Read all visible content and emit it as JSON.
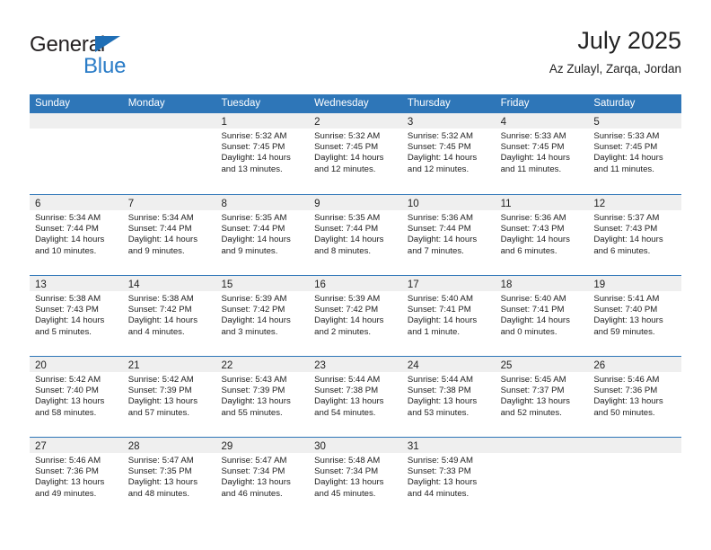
{
  "brand": {
    "name_top": "General",
    "name_bottom": "Blue",
    "triangle_color": "#1f6eb5",
    "text_color_top": "#231f20",
    "text_color_bottom": "#2a7cc7"
  },
  "header": {
    "title": "July 2025",
    "subtitle": "Az Zulayl, Zarqa, Jordan"
  },
  "theme": {
    "header_blue": "#2e76b8",
    "day_band_gray": "#efefef",
    "text": "#222222"
  },
  "weekdays": [
    "Sunday",
    "Monday",
    "Tuesday",
    "Wednesday",
    "Thursday",
    "Friday",
    "Saturday"
  ],
  "weeks": [
    [
      {
        "day": "",
        "empty": true,
        "sunrise": "",
        "sunset": "",
        "daylight": ""
      },
      {
        "day": "",
        "empty": true,
        "sunrise": "",
        "sunset": "",
        "daylight": ""
      },
      {
        "day": "1",
        "sunrise": "Sunrise: 5:32 AM",
        "sunset": "Sunset: 7:45 PM",
        "daylight": "Daylight: 14 hours and 13 minutes."
      },
      {
        "day": "2",
        "sunrise": "Sunrise: 5:32 AM",
        "sunset": "Sunset: 7:45 PM",
        "daylight": "Daylight: 14 hours and 12 minutes."
      },
      {
        "day": "3",
        "sunrise": "Sunrise: 5:32 AM",
        "sunset": "Sunset: 7:45 PM",
        "daylight": "Daylight: 14 hours and 12 minutes."
      },
      {
        "day": "4",
        "sunrise": "Sunrise: 5:33 AM",
        "sunset": "Sunset: 7:45 PM",
        "daylight": "Daylight: 14 hours and 11 minutes."
      },
      {
        "day": "5",
        "sunrise": "Sunrise: 5:33 AM",
        "sunset": "Sunset: 7:45 PM",
        "daylight": "Daylight: 14 hours and 11 minutes."
      }
    ],
    [
      {
        "day": "6",
        "sunrise": "Sunrise: 5:34 AM",
        "sunset": "Sunset: 7:44 PM",
        "daylight": "Daylight: 14 hours and 10 minutes."
      },
      {
        "day": "7",
        "sunrise": "Sunrise: 5:34 AM",
        "sunset": "Sunset: 7:44 PM",
        "daylight": "Daylight: 14 hours and 9 minutes."
      },
      {
        "day": "8",
        "sunrise": "Sunrise: 5:35 AM",
        "sunset": "Sunset: 7:44 PM",
        "daylight": "Daylight: 14 hours and 9 minutes."
      },
      {
        "day": "9",
        "sunrise": "Sunrise: 5:35 AM",
        "sunset": "Sunset: 7:44 PM",
        "daylight": "Daylight: 14 hours and 8 minutes."
      },
      {
        "day": "10",
        "sunrise": "Sunrise: 5:36 AM",
        "sunset": "Sunset: 7:44 PM",
        "daylight": "Daylight: 14 hours and 7 minutes."
      },
      {
        "day": "11",
        "sunrise": "Sunrise: 5:36 AM",
        "sunset": "Sunset: 7:43 PM",
        "daylight": "Daylight: 14 hours and 6 minutes."
      },
      {
        "day": "12",
        "sunrise": "Sunrise: 5:37 AM",
        "sunset": "Sunset: 7:43 PM",
        "daylight": "Daylight: 14 hours and 6 minutes."
      }
    ],
    [
      {
        "day": "13",
        "sunrise": "Sunrise: 5:38 AM",
        "sunset": "Sunset: 7:43 PM",
        "daylight": "Daylight: 14 hours and 5 minutes."
      },
      {
        "day": "14",
        "sunrise": "Sunrise: 5:38 AM",
        "sunset": "Sunset: 7:42 PM",
        "daylight": "Daylight: 14 hours and 4 minutes."
      },
      {
        "day": "15",
        "sunrise": "Sunrise: 5:39 AM",
        "sunset": "Sunset: 7:42 PM",
        "daylight": "Daylight: 14 hours and 3 minutes."
      },
      {
        "day": "16",
        "sunrise": "Sunrise: 5:39 AM",
        "sunset": "Sunset: 7:42 PM",
        "daylight": "Daylight: 14 hours and 2 minutes."
      },
      {
        "day": "17",
        "sunrise": "Sunrise: 5:40 AM",
        "sunset": "Sunset: 7:41 PM",
        "daylight": "Daylight: 14 hours and 1 minute."
      },
      {
        "day": "18",
        "sunrise": "Sunrise: 5:40 AM",
        "sunset": "Sunset: 7:41 PM",
        "daylight": "Daylight: 14 hours and 0 minutes."
      },
      {
        "day": "19",
        "sunrise": "Sunrise: 5:41 AM",
        "sunset": "Sunset: 7:40 PM",
        "daylight": "Daylight: 13 hours and 59 minutes."
      }
    ],
    [
      {
        "day": "20",
        "sunrise": "Sunrise: 5:42 AM",
        "sunset": "Sunset: 7:40 PM",
        "daylight": "Daylight: 13 hours and 58 minutes."
      },
      {
        "day": "21",
        "sunrise": "Sunrise: 5:42 AM",
        "sunset": "Sunset: 7:39 PM",
        "daylight": "Daylight: 13 hours and 57 minutes."
      },
      {
        "day": "22",
        "sunrise": "Sunrise: 5:43 AM",
        "sunset": "Sunset: 7:39 PM",
        "daylight": "Daylight: 13 hours and 55 minutes."
      },
      {
        "day": "23",
        "sunrise": "Sunrise: 5:44 AM",
        "sunset": "Sunset: 7:38 PM",
        "daylight": "Daylight: 13 hours and 54 minutes."
      },
      {
        "day": "24",
        "sunrise": "Sunrise: 5:44 AM",
        "sunset": "Sunset: 7:38 PM",
        "daylight": "Daylight: 13 hours and 53 minutes."
      },
      {
        "day": "25",
        "sunrise": "Sunrise: 5:45 AM",
        "sunset": "Sunset: 7:37 PM",
        "daylight": "Daylight: 13 hours and 52 minutes."
      },
      {
        "day": "26",
        "sunrise": "Sunrise: 5:46 AM",
        "sunset": "Sunset: 7:36 PM",
        "daylight": "Daylight: 13 hours and 50 minutes."
      }
    ],
    [
      {
        "day": "27",
        "sunrise": "Sunrise: 5:46 AM",
        "sunset": "Sunset: 7:36 PM",
        "daylight": "Daylight: 13 hours and 49 minutes."
      },
      {
        "day": "28",
        "sunrise": "Sunrise: 5:47 AM",
        "sunset": "Sunset: 7:35 PM",
        "daylight": "Daylight: 13 hours and 48 minutes."
      },
      {
        "day": "29",
        "sunrise": "Sunrise: 5:47 AM",
        "sunset": "Sunset: 7:34 PM",
        "daylight": "Daylight: 13 hours and 46 minutes."
      },
      {
        "day": "30",
        "sunrise": "Sunrise: 5:48 AM",
        "sunset": "Sunset: 7:34 PM",
        "daylight": "Daylight: 13 hours and 45 minutes."
      },
      {
        "day": "31",
        "sunrise": "Sunrise: 5:49 AM",
        "sunset": "Sunset: 7:33 PM",
        "daylight": "Daylight: 13 hours and 44 minutes."
      },
      {
        "day": "",
        "empty": true,
        "sunrise": "",
        "sunset": "",
        "daylight": ""
      },
      {
        "day": "",
        "empty": true,
        "sunrise": "",
        "sunset": "",
        "daylight": ""
      }
    ]
  ]
}
